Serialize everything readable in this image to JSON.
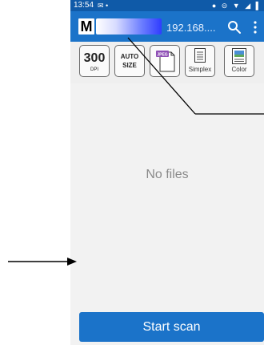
{
  "status_bar": {
    "time": "13:54",
    "left_icons": "✉ •",
    "right_icons": "● ⊝ ▼ ◢ ▌"
  },
  "app_bar": {
    "logo_letter": "M",
    "ip_text": "192.168...."
  },
  "toolbar": {
    "resolution_value": "300",
    "resolution_unit": "DPI",
    "size_label_line1": "AUTO",
    "size_label_line2": "SIZE",
    "format_label": "JPEG",
    "duplex_label": "Simplex",
    "color_label": "Color"
  },
  "content": {
    "empty_message": "No files"
  },
  "footer": {
    "scan_button_label": "Start scan"
  },
  "colors": {
    "app_bar_blue": "#1b73c9",
    "status_bar_blue": "#0f5aa8",
    "background": "#f2f2f2"
  }
}
